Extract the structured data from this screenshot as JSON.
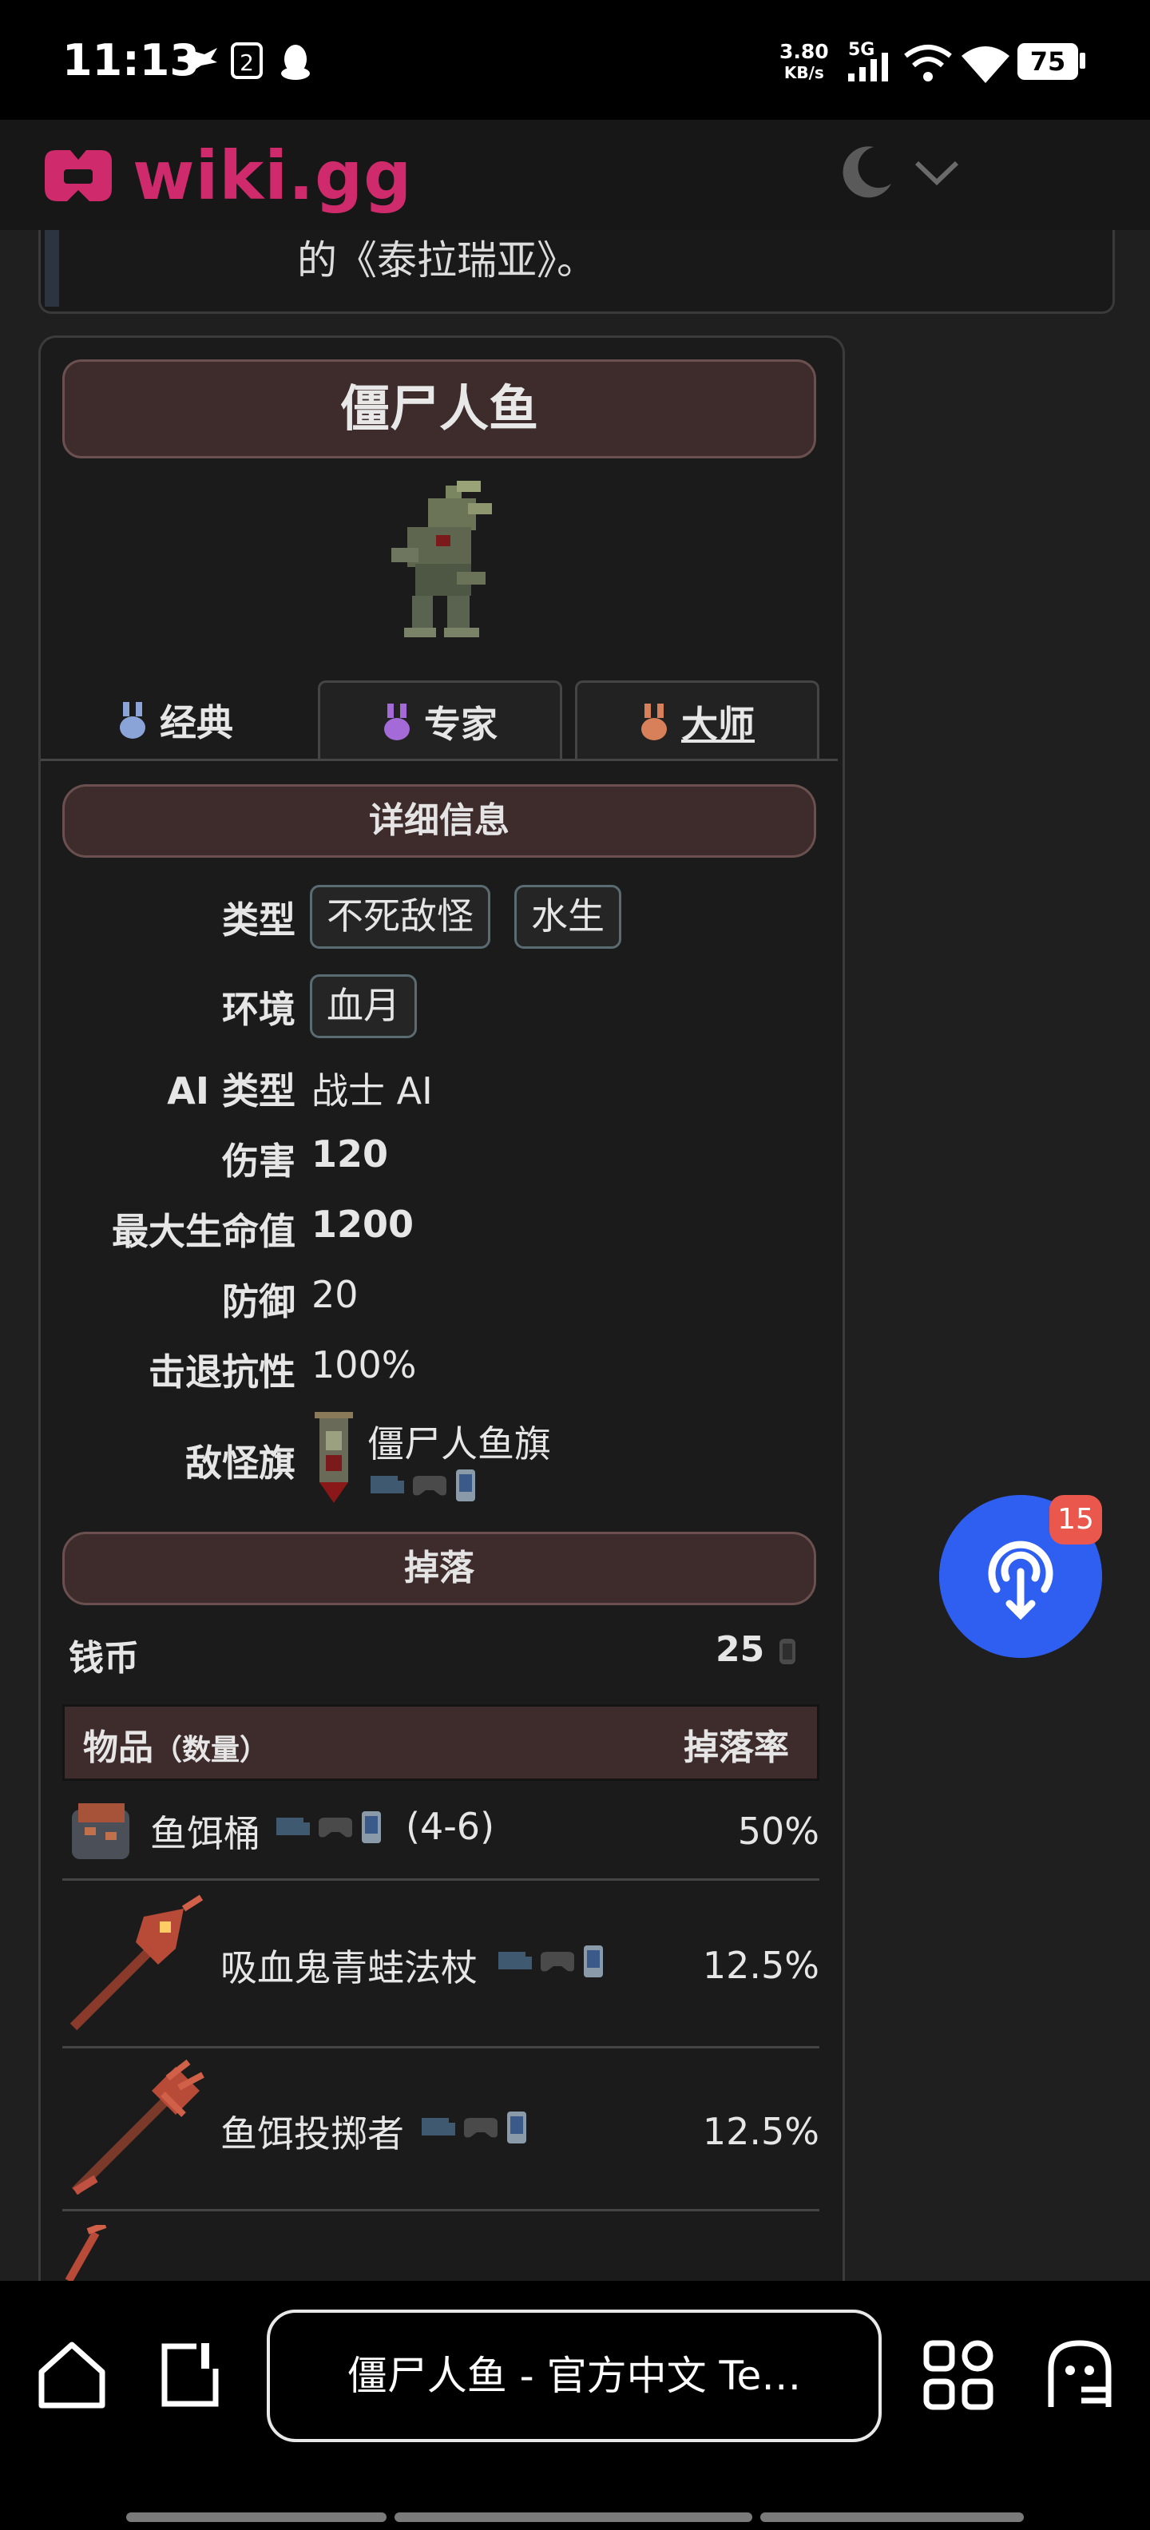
{
  "status_bar": {
    "time": "11:13",
    "net_speed_value": "3.80",
    "net_speed_unit": "KB/s",
    "network": "5G",
    "battery": "75",
    "icons": [
      "bird-icon",
      "sim-icon",
      "penguin-icon",
      "signal-icon",
      "wifi-hotspot-icon",
      "wifi-icon",
      "battery-icon"
    ]
  },
  "site": {
    "logo_text": "wiki.gg",
    "accent": "#cf2a6b"
  },
  "intro_card": {
    "text": "的《泰拉瑞亚》。"
  },
  "infobox": {
    "title": "僵尸人鱼",
    "tabs": [
      {
        "label": "经典",
        "color": "#8aa4d8"
      },
      {
        "label": "专家",
        "color": "#a46ad8"
      },
      {
        "label": "大师",
        "color": "#d8805a"
      }
    ],
    "details_header": "详细信息",
    "details": {
      "type_label": "类型",
      "type_values": [
        "不死敌怪",
        "水生"
      ],
      "env_label": "环境",
      "env_value": "血月",
      "ai_label": "AI 类型",
      "ai_value": "战士 AI",
      "damage_label": "伤害",
      "damage_value": "120",
      "maxlife_label": "最大生命值",
      "maxlife_value": "1200",
      "defense_label": "防御",
      "defense_value": "20",
      "kb_label": "击退抗性",
      "kb_value": "100%",
      "banner_label": "敌怪旗",
      "banner_value": "僵尸人鱼旗"
    },
    "drops_header": "掉落",
    "coins_label": "钱币",
    "coins_value": "25",
    "table_header_item": "物品",
    "table_header_qty": "（数量）",
    "table_header_rate": "掉落率",
    "drops": [
      {
        "name": "鱼饵桶",
        "qty": "(4-6)",
        "rate": "50%"
      },
      {
        "name": "吸血鬼青蛙法杖",
        "qty": "",
        "rate": "12.5%"
      },
      {
        "name": "鱼饵投掷者",
        "qty": "",
        "rate": "12.5%"
      }
    ]
  },
  "fab": {
    "badge": "15"
  },
  "browser": {
    "tab_title": "僵尸人鱼 - 官方中文 Te…"
  }
}
